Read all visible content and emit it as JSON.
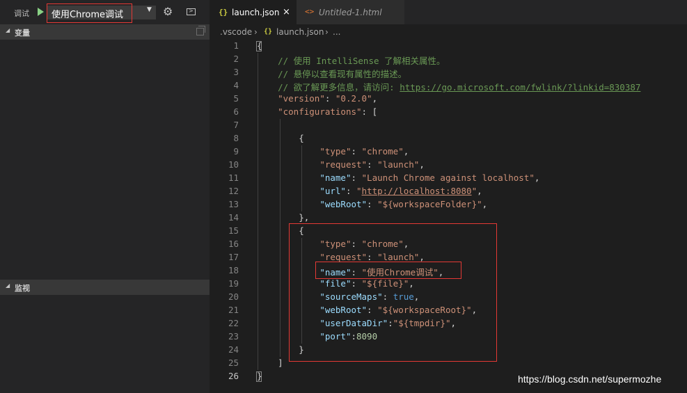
{
  "debug": {
    "label": "调试",
    "config": "使用Chrome调试"
  },
  "sections": {
    "variables": "变量",
    "watch": "监视"
  },
  "tabs": [
    {
      "icon": "{}",
      "label": "launch.json",
      "close": "×"
    },
    {
      "icon": "<>",
      "label": "Untitled-1.html"
    }
  ],
  "breadcrumb": {
    "folder": ".vscode",
    "sep": "›",
    "icon": "{}",
    "file": "launch.json",
    "more": "..."
  },
  "colors": {
    "editor_bg": "#1e1e1e",
    "sidebar_bg": "#252526",
    "highlight_box": "#e53935",
    "comment": "#6a9955",
    "key": "#9cdcfe",
    "string": "#ce9178"
  },
  "code_lines": [
    {
      "n": "1",
      "parts": [
        [
          "p",
          "{"
        ]
      ]
    },
    {
      "n": "2",
      "parts": [
        [
          "c",
          "    // 使用 IntelliSense 了解相关属性。"
        ]
      ]
    },
    {
      "n": "3",
      "parts": [
        [
          "c",
          "    // 悬停以查看现有属性的描述。"
        ]
      ]
    },
    {
      "n": "4",
      "parts": [
        [
          "c",
          "    // 欲了解更多信息，请访问: "
        ],
        [
          "cl",
          "https://go.microsoft.com/fwlink/?linkid=830387"
        ]
      ]
    },
    {
      "n": "5",
      "parts": [
        [
          "p",
          "    "
        ],
        [
          "s",
          "\"version\""
        ],
        [
          "p",
          ": "
        ],
        [
          "s",
          "\"0.2.0\""
        ],
        [
          "p",
          ","
        ]
      ]
    },
    {
      "n": "6",
      "parts": [
        [
          "p",
          "    "
        ],
        [
          "s",
          "\"configurations\""
        ],
        [
          "p",
          ": ["
        ]
      ]
    },
    {
      "n": "7",
      "parts": [
        [
          "p",
          ""
        ]
      ]
    },
    {
      "n": "8",
      "parts": [
        [
          "p",
          "        {"
        ]
      ]
    },
    {
      "n": "9",
      "parts": [
        [
          "p",
          "            "
        ],
        [
          "s",
          "\"type\""
        ],
        [
          "p",
          ": "
        ],
        [
          "s",
          "\"chrome\""
        ],
        [
          "p",
          ","
        ]
      ]
    },
    {
      "n": "10",
      "parts": [
        [
          "p",
          "            "
        ],
        [
          "s",
          "\"request\""
        ],
        [
          "p",
          ": "
        ],
        [
          "s",
          "\"launch\""
        ],
        [
          "p",
          ","
        ]
      ]
    },
    {
      "n": "11",
      "parts": [
        [
          "p",
          "            "
        ],
        [
          "k",
          "\"name\""
        ],
        [
          "p",
          ": "
        ],
        [
          "s",
          "\"Launch Chrome against localhost\""
        ],
        [
          "p",
          ","
        ]
      ]
    },
    {
      "n": "12",
      "parts": [
        [
          "p",
          "            "
        ],
        [
          "k",
          "\"url\""
        ],
        [
          "p",
          ": "
        ],
        [
          "s",
          "\""
        ],
        [
          "sl",
          "http://localhost:8080"
        ],
        [
          "s",
          "\""
        ],
        [
          "p",
          ","
        ]
      ]
    },
    {
      "n": "13",
      "parts": [
        [
          "p",
          "            "
        ],
        [
          "k",
          "\"webRoot\""
        ],
        [
          "p",
          ": "
        ],
        [
          "s",
          "\"${workspaceFolder}\""
        ],
        [
          "p",
          ","
        ]
      ]
    },
    {
      "n": "14",
      "parts": [
        [
          "p",
          "        },"
        ]
      ]
    },
    {
      "n": "15",
      "parts": [
        [
          "p",
          "        {"
        ]
      ]
    },
    {
      "n": "16",
      "parts": [
        [
          "p",
          "            "
        ],
        [
          "s",
          "\"type\""
        ],
        [
          "p",
          ": "
        ],
        [
          "s",
          "\"chrome\""
        ],
        [
          "p",
          ","
        ]
      ]
    },
    {
      "n": "17",
      "parts": [
        [
          "p",
          "            "
        ],
        [
          "s",
          "\"request\""
        ],
        [
          "p",
          ": "
        ],
        [
          "s",
          "\"launch\""
        ],
        [
          "p",
          ","
        ]
      ]
    },
    {
      "n": "18",
      "parts": [
        [
          "p",
          "            "
        ],
        [
          "k",
          "\"name\""
        ],
        [
          "p",
          ": "
        ],
        [
          "s",
          "\"使用Chrome调试\""
        ],
        [
          "p",
          ","
        ]
      ]
    },
    {
      "n": "19",
      "parts": [
        [
          "p",
          "            "
        ],
        [
          "k",
          "\"file\""
        ],
        [
          "p",
          ": "
        ],
        [
          "s",
          "\"${file}\""
        ],
        [
          "p",
          ","
        ]
      ]
    },
    {
      "n": "20",
      "parts": [
        [
          "p",
          "            "
        ],
        [
          "k",
          "\"sourceMaps\""
        ],
        [
          "p",
          ": "
        ],
        [
          "b",
          "true"
        ],
        [
          "p",
          ","
        ]
      ]
    },
    {
      "n": "21",
      "parts": [
        [
          "p",
          "            "
        ],
        [
          "k",
          "\"webRoot\""
        ],
        [
          "p",
          ": "
        ],
        [
          "s",
          "\"${workspaceRoot}\""
        ],
        [
          "p",
          ","
        ]
      ]
    },
    {
      "n": "22",
      "parts": [
        [
          "p",
          "            "
        ],
        [
          "k",
          "\"userDataDir\""
        ],
        [
          "p",
          ":"
        ],
        [
          "s",
          "\"${tmpdir}\""
        ],
        [
          "p",
          ","
        ]
      ]
    },
    {
      "n": "23",
      "parts": [
        [
          "p",
          "            "
        ],
        [
          "k",
          "\"port\""
        ],
        [
          "p",
          ":"
        ],
        [
          "num",
          "8090"
        ]
      ]
    },
    {
      "n": "24",
      "parts": [
        [
          "p",
          "        }"
        ]
      ]
    },
    {
      "n": "25",
      "parts": [
        [
          "p",
          "    ]"
        ]
      ]
    },
    {
      "n": "26",
      "parts": [
        [
          "p",
          "}"
        ]
      ]
    }
  ],
  "watermark": "https://blog.csdn.net/supermozhe"
}
